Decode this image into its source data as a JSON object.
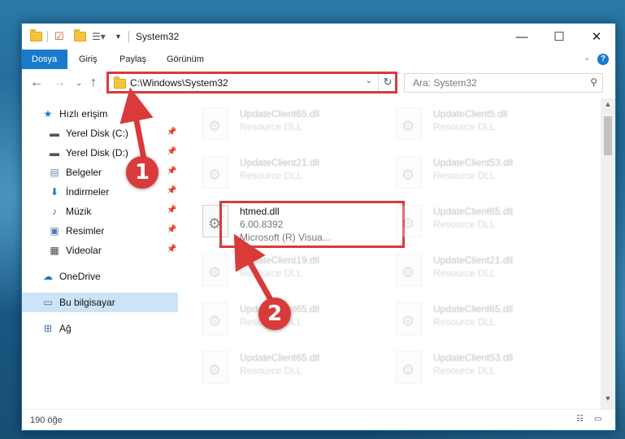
{
  "window": {
    "title": "System32",
    "controls": {
      "minimize": "—",
      "maximize": "☐",
      "close": "✕"
    }
  },
  "ribbon": {
    "tabs": [
      "Dosya",
      "Giriş",
      "Paylaş",
      "Görünüm"
    ],
    "active_tab": "Dosya",
    "help_label": "?"
  },
  "address": {
    "path": "C:\\Windows\\System32",
    "search_placeholder": "Ara: System32"
  },
  "sidebar": {
    "quick_access": "Hızlı erişim",
    "items": [
      {
        "label": "Yerel Disk (C:)",
        "icon": "drive-icon"
      },
      {
        "label": "Yerel Disk (D:)",
        "icon": "drive-icon"
      },
      {
        "label": "Belgeler",
        "icon": "documents-icon"
      },
      {
        "label": "İndirmeler",
        "icon": "download-icon"
      },
      {
        "label": "Müzik",
        "icon": "music-icon"
      },
      {
        "label": "Resimler",
        "icon": "pictures-icon"
      },
      {
        "label": "Videolar",
        "icon": "video-icon"
      }
    ],
    "onedrive": "OneDrive",
    "this_pc": "Bu bilgisayar",
    "network": "Ağ"
  },
  "files": {
    "left_column": [
      {
        "name": "UpdateClient65.dll",
        "desc": "Resource DLL"
      },
      {
        "name": "UpdateClient21.dll",
        "desc": "Resource DLL"
      },
      {
        "name": "htmed.dll",
        "desc": "6.00.8392",
        "desc2": "Microsoft (R) Visua..."
      },
      {
        "name": "UpdateClient19.dll",
        "desc": "Resource DLL"
      },
      {
        "name": "UpdateClient65.dll",
        "desc": "Resource DLL"
      },
      {
        "name": "UpdateClient65.dll",
        "desc": "Resource DLL"
      }
    ],
    "right_column": [
      {
        "name": "UpdateClient5.dll",
        "desc": "Resource DLL"
      },
      {
        "name": "UpdateClient53.dll",
        "desc": "Resource DLL"
      },
      {
        "name": "UpdateClient65.dll",
        "desc": "Resource DLL"
      },
      {
        "name": "UpdateClient21.dll",
        "desc": "Resource DLL"
      },
      {
        "name": "UpdateClient65.dll",
        "desc": "Resource DLL"
      },
      {
        "name": "UpdateClient53.dll",
        "desc": "Resource DLL"
      }
    ]
  },
  "status": {
    "count": "190 öğe"
  },
  "annotations": {
    "badge1": "1",
    "badge2": "2",
    "color": "#d93a3a"
  }
}
